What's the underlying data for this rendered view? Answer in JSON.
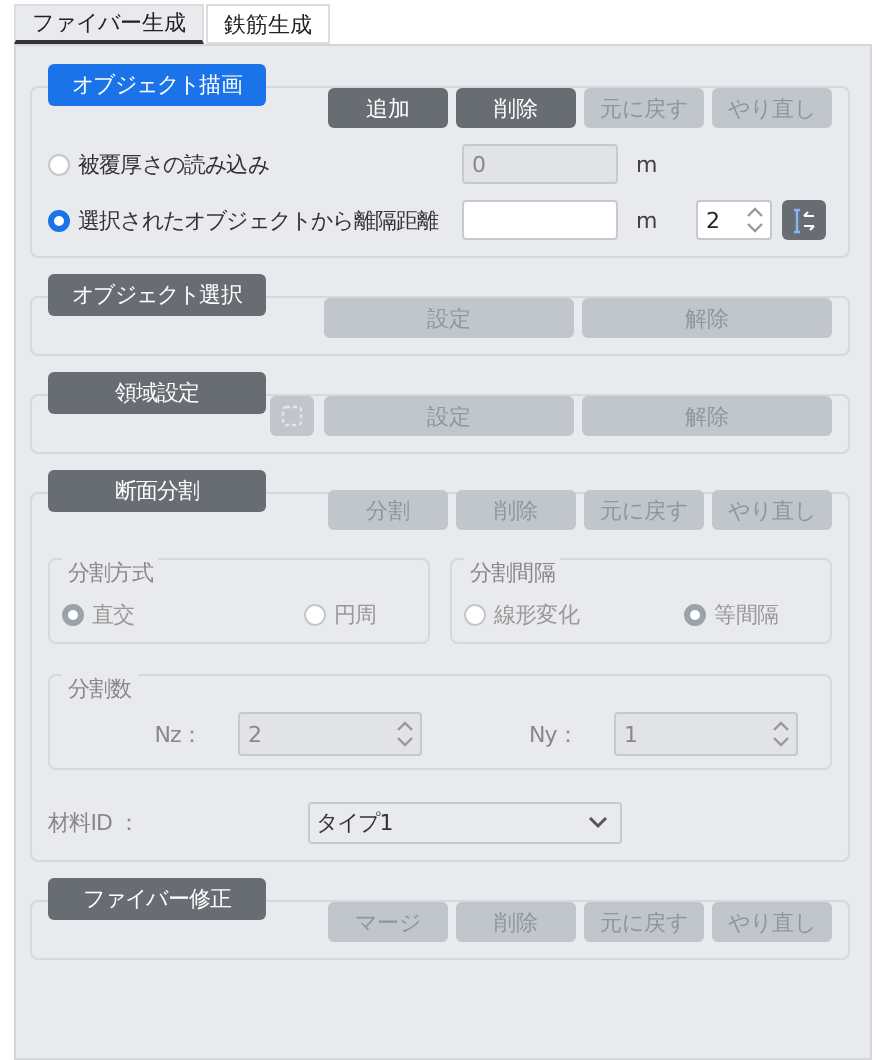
{
  "tabs": [
    {
      "label": "ファイバー生成",
      "selected": true
    },
    {
      "label": "鉄筋生成",
      "selected": false
    }
  ],
  "object_drawing": {
    "title": "オブジェクト描画",
    "active": true,
    "buttons": [
      {
        "label": "追加",
        "disabled": false
      },
      {
        "label": "削除",
        "disabled": false
      },
      {
        "label": "元に戻す",
        "disabled": true
      },
      {
        "label": "やり直し",
        "disabled": true
      }
    ],
    "options": [
      {
        "label": "被覆厚さの読み込み",
        "selected": false,
        "value": "0",
        "unit": "m",
        "disabled": true
      },
      {
        "label": "選択されたオブジェクトから離隔距離",
        "selected": true,
        "unit": "m",
        "disabled": false,
        "count": "2"
      }
    ]
  },
  "object_selection": {
    "title": "オブジェクト選択",
    "active": false,
    "buttons": [
      {
        "label": "設定",
        "disabled": true
      },
      {
        "label": "解除",
        "disabled": true
      }
    ]
  },
  "region_setting": {
    "title": "領域設定",
    "active": false,
    "buttons": [
      {
        "label": "設定",
        "disabled": true
      },
      {
        "label": "解除",
        "disabled": true
      }
    ]
  },
  "section_division": {
    "title": "断面分割",
    "active": false,
    "buttons": [
      {
        "label": "分割",
        "disabled": true
      },
      {
        "label": "削除",
        "disabled": true
      },
      {
        "label": "元に戻す",
        "disabled": true
      },
      {
        "label": "やり直し",
        "disabled": true
      }
    ],
    "groups": [
      {
        "title": "分割方式",
        "options": [
          {
            "label": "直交",
            "selected": true
          },
          {
            "label": "円周",
            "selected": false
          }
        ]
      },
      {
        "title": "分割間隔",
        "options": [
          {
            "label": "線形変化",
            "selected": false
          },
          {
            "label": "等間隔",
            "selected": true
          }
        ]
      }
    ],
    "counts": {
      "title": "分割数",
      "fields": [
        {
          "label": "Nz：",
          "value": "2"
        },
        {
          "label": "Ny：",
          "value": "1"
        }
      ]
    },
    "material": {
      "label": "材料ID ：",
      "value": "タイプ1"
    }
  },
  "fiber_correction": {
    "title": "ファイバー修正",
    "active": false,
    "buttons": [
      {
        "label": "マージ",
        "disabled": true
      },
      {
        "label": "削除",
        "disabled": true
      },
      {
        "label": "元に戻す",
        "disabled": true
      },
      {
        "label": "やり直し",
        "disabled": true
      }
    ]
  }
}
